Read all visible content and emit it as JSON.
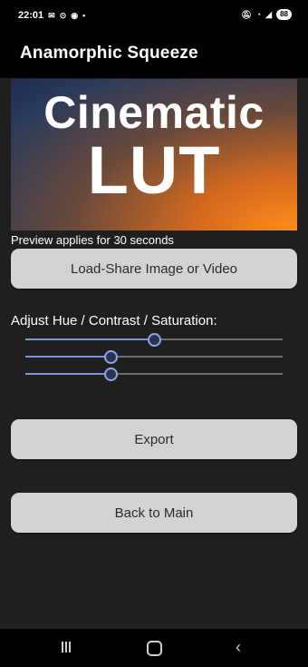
{
  "status_bar": {
    "time": "22:01",
    "left_icons": [
      "notification-icon",
      "alarm-icon",
      "sync-icon",
      "dot-icon"
    ],
    "right_icons": [
      "mute-icon",
      "wifi-icon",
      "signal-icon"
    ],
    "battery": "88"
  },
  "app_bar": {
    "title": "Anamorphic Squeeze"
  },
  "preview": {
    "line1": "Cinematic",
    "line2": "LUT",
    "note": "Preview applies for 30 seconds"
  },
  "load_button": {
    "label": "Load-Share Image or Video"
  },
  "adjust": {
    "label": "Adjust Hue / Contrast / Saturation:",
    "hue_value": 0.5,
    "contrast_value": 0.33,
    "saturation_value": 0.33
  },
  "export_button": {
    "label": "Export"
  },
  "back_button": {
    "label": "Back to Main"
  },
  "nav_bar": {
    "icons": [
      "recents-icon",
      "home-icon",
      "back-icon"
    ]
  },
  "colors": {
    "slider_accent": "#8ea4e6",
    "button_bg": "#d3d3d3",
    "background": "#1f1f1f"
  }
}
